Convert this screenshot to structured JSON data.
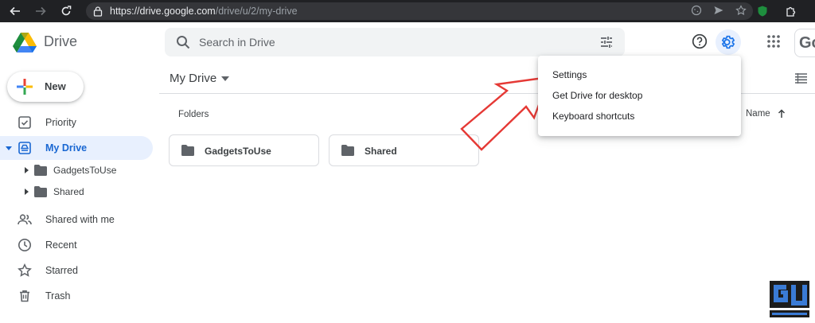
{
  "browser": {
    "url_main": "https://drive.google.com",
    "url_path": "/drive/u/2/my-drive"
  },
  "header": {
    "app_name": "Drive",
    "search_placeholder": "Search in Drive",
    "account_letters": "Go"
  },
  "sidebar": {
    "new_label": "New",
    "items": [
      {
        "label": "Priority",
        "icon": "priority-icon"
      },
      {
        "label": "My Drive",
        "icon": "my-drive-icon"
      },
      {
        "label": "GadgetsToUse",
        "icon": "folder-icon"
      },
      {
        "label": "Shared",
        "icon": "folder-icon"
      },
      {
        "label": "Shared with me",
        "icon": "people-icon"
      },
      {
        "label": "Recent",
        "icon": "clock-icon"
      },
      {
        "label": "Starred",
        "icon": "star-icon"
      },
      {
        "label": "Trash",
        "icon": "trash-icon"
      }
    ]
  },
  "main": {
    "title": "My Drive",
    "folders_label": "Folders",
    "sort_label": "Name",
    "folders": [
      {
        "name": "GadgetsToUse"
      },
      {
        "name": "Shared"
      }
    ]
  },
  "settings_menu": {
    "items": [
      "Settings",
      "Get Drive for desktop",
      "Keyboard shortcuts"
    ]
  },
  "colors": {
    "accent": "#1a73e8",
    "active_bg": "#e8f0fe",
    "annotation": "#e53935",
    "browser_bar": "#202124"
  },
  "watermark": "GADGETS TO USE"
}
